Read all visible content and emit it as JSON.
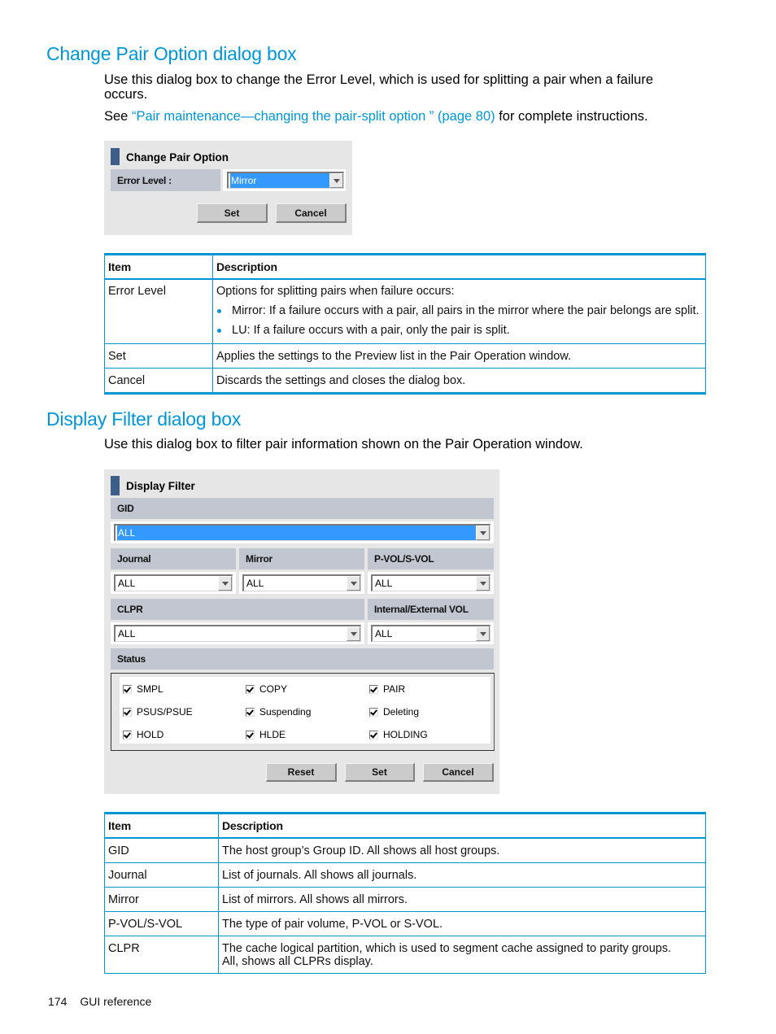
{
  "section1": {
    "heading": "Change Pair Option dialog box",
    "intro": "Use this dialog box to change the Error Level, which is used for splitting a pair when a failure occurs.",
    "see_prefix": "See ",
    "see_link": "“Pair maintenance—changing the pair-split option ” (page 80)",
    "see_suffix": " for complete instructions.",
    "dialog": {
      "title": "Change Pair Option",
      "error_level_label": "Error Level :",
      "error_level_value": "Mirror",
      "set_label": "Set",
      "cancel_label": "Cancel"
    },
    "table": {
      "headers": [
        "Item",
        "Description"
      ],
      "rows": [
        {
          "item": "Error Level",
          "description": "Options for splitting pairs when failure occurs:",
          "bullets": [
            "Mirror: If a failure occurs with a pair, all pairs in the mirror where the pair belongs are split.",
            "LU: If a failure occurs with a pair, only the pair is split."
          ]
        },
        {
          "item": "Set",
          "description": "Applies the settings to the Preview list in the Pair Operation window."
        },
        {
          "item": "Cancel",
          "description": "Discards the settings and closes the dialog box."
        }
      ]
    }
  },
  "section2": {
    "heading": "Display Filter dialog box",
    "intro": "Use this dialog box to filter pair information shown on the Pair Operation window.",
    "dialog": {
      "title": "Display Filter",
      "gid_label": "GID",
      "gid_value": "ALL",
      "journal_label": "Journal",
      "journal_value": "ALL",
      "mirror_label": "Mirror",
      "mirror_value": "ALL",
      "pvol_label": "P-VOL/S-VOL",
      "pvol_value": "ALL",
      "clpr_label": "CLPR",
      "clpr_value": "ALL",
      "intext_label": "Internal/External VOL",
      "intext_value": "ALL",
      "status_label": "Status",
      "status_items": [
        {
          "label": "SMPL",
          "checked": true
        },
        {
          "label": "COPY",
          "checked": true
        },
        {
          "label": "PAIR",
          "checked": true
        },
        {
          "label": "PSUS/PSUE",
          "checked": true
        },
        {
          "label": "Suspending",
          "checked": true
        },
        {
          "label": "Deleting",
          "checked": true
        },
        {
          "label": "HOLD",
          "checked": true
        },
        {
          "label": "HLDE",
          "checked": true
        },
        {
          "label": "HOLDING",
          "checked": true
        }
      ],
      "reset_label": "Reset",
      "set_label": "Set",
      "cancel_label": "Cancel"
    },
    "table": {
      "headers": [
        "Item",
        "Description"
      ],
      "rows": [
        {
          "item": "GID",
          "description": "The host group’s Group ID. All shows all host groups."
        },
        {
          "item": "Journal",
          "description": "List of journals. All shows all journals."
        },
        {
          "item": "Mirror",
          "description": "List of mirrors. All shows all mirrors."
        },
        {
          "item": "P-VOL/S-VOL",
          "description": "The type of pair volume, P-VOL or S-VOL."
        },
        {
          "item": "CLPR",
          "description": "The cache logical partition, which is used to segment cache assigned to parity groups. All, shows all CLPRs display."
        }
      ]
    }
  },
  "footer": {
    "page_number": "174",
    "section_name": "GUI reference"
  },
  "colors": {
    "accent": "#0096d6",
    "dialog_bg": "#e6e6e6",
    "band_bg": "#c1c6d1",
    "selection": "#3399ff",
    "title_bar": "#3d5e87"
  }
}
